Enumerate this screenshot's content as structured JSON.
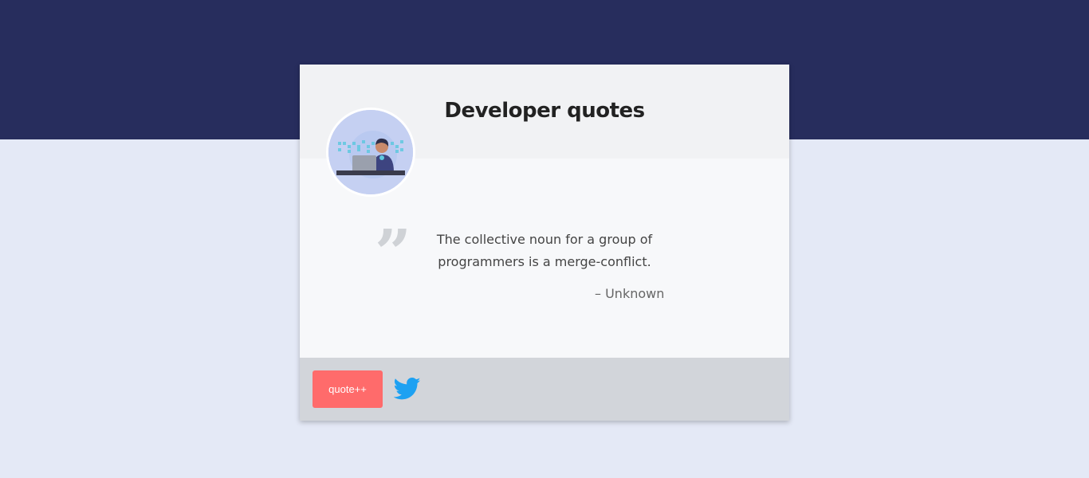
{
  "header": {
    "title": "Developer quotes"
  },
  "quote": {
    "text": "The collective noun for a group of programmers is a merge-conflict.",
    "author": "– Unknown"
  },
  "footer": {
    "new_quote_label": "quote++",
    "share_icon": "twitter-icon"
  },
  "colors": {
    "top_band": "#272d5d",
    "page_background": "#e4e9f6",
    "button": "#ff6b6b",
    "twitter": "#1da1f2"
  }
}
